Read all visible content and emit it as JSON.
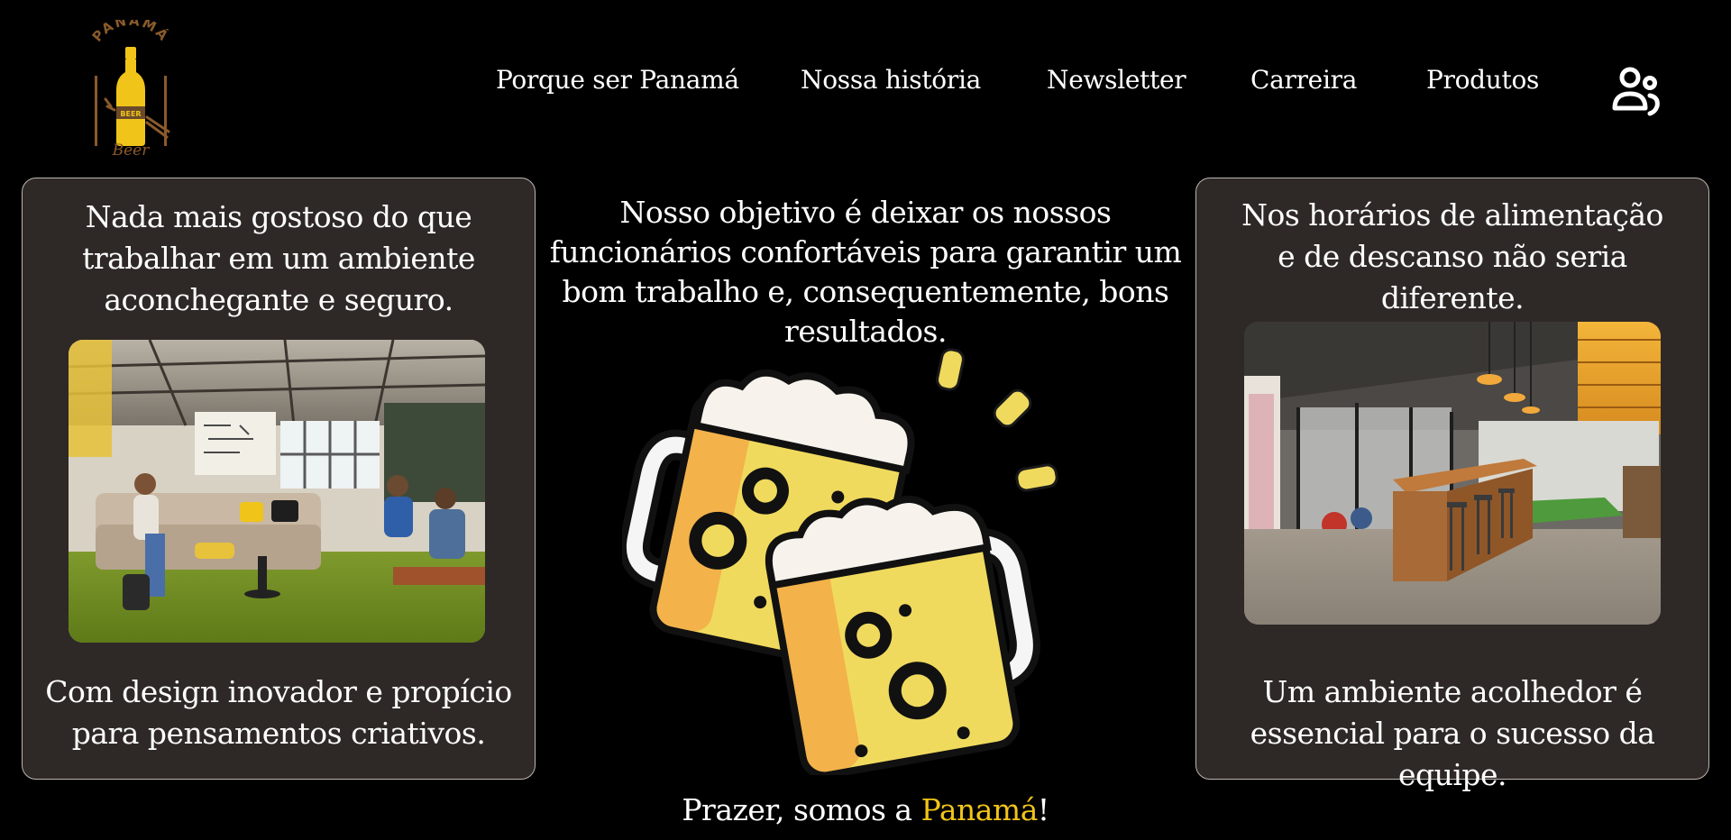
{
  "header": {
    "logo": {
      "arc_text": "PANAMÁ",
      "label_text": "BEER",
      "script_text": "Beer",
      "icon": "beer-bottle-logo"
    },
    "nav": [
      {
        "label": "Porque ser Panamá"
      },
      {
        "label": "Nossa história"
      },
      {
        "label": "Newsletter"
      },
      {
        "label": "Carreira"
      },
      {
        "label": "Produtos"
      }
    ],
    "user_icon": "users-icon"
  },
  "left_card": {
    "top_text": "Nada mais gostoso do que trabalhar em um ambiente aconchegante e seguro.",
    "bottom_text": "Com design inovador e propício para pensamentos criativos."
  },
  "center": {
    "text": "Nosso objetivo é deixar os nossos funcionários confortáveis para garantir um bom trabalho e, consequentemente, bons resultados.",
    "illustration": "beer-mugs-toast-icon",
    "tagline_prefix": "Prazer, somos a ",
    "tagline_brand": "Panamá",
    "tagline_suffix": "!"
  },
  "right_card": {
    "top_text": "Nos horários de alimentação e de descanso não seria diferente.",
    "bottom_text": "Um ambiente acolhedor é essencial para o sucesso da equipe."
  },
  "colors": {
    "background": "#000000",
    "card_bg": "#2e2926",
    "accent": "#f0c419",
    "logo_brown": "#8a5a2b"
  }
}
